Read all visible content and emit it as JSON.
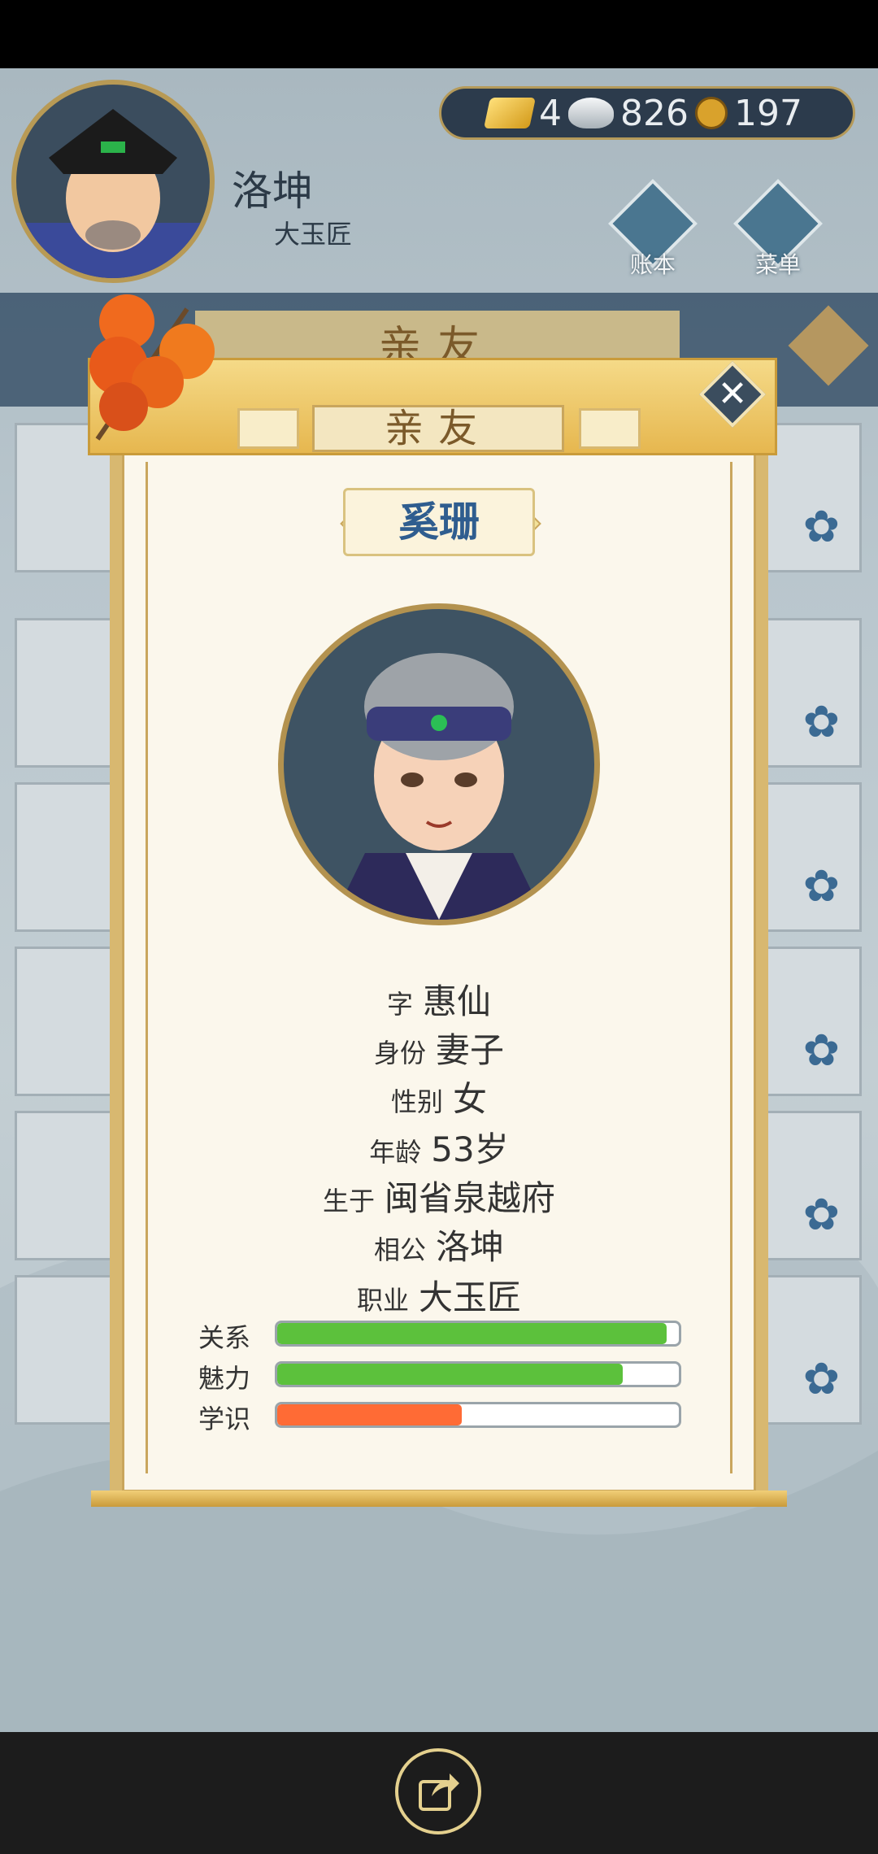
{
  "player": {
    "name": "洛坤",
    "job": "大玉匠"
  },
  "currency": {
    "gold": "4",
    "silver": "826",
    "coins": "197"
  },
  "menu": {
    "ledger_label": "账本",
    "menu_label": "菜单"
  },
  "background_panel": {
    "title": "亲友"
  },
  "modal": {
    "title": "亲友",
    "person_name": "奚珊",
    "details": [
      {
        "key": "字",
        "value": "惠仙"
      },
      {
        "key": "身份",
        "value": "妻子"
      },
      {
        "key": "性别",
        "value": "女"
      },
      {
        "key": "年龄",
        "value": "53岁"
      },
      {
        "key": "生于",
        "value": "闽省泉越府"
      },
      {
        "key": "相公",
        "value": "洛坤"
      },
      {
        "key": "职业",
        "value": "大玉匠"
      }
    ],
    "stats": [
      {
        "label": "关系",
        "value": 0.97,
        "color": "#5cc13c"
      },
      {
        "label": "魅力",
        "value": 0.86,
        "color": "#5cc13c"
      },
      {
        "label": "学识",
        "value": 0.46,
        "color": "#ff6b35"
      }
    ]
  },
  "icons": [
    "gold-bar-icon",
    "silver-ingot-icon",
    "copper-coin-icon",
    "ledger-icon",
    "menu-dots-icon",
    "close-icon",
    "share-icon",
    "hawthorn-candy-icon",
    "plum-flower-icon"
  ]
}
